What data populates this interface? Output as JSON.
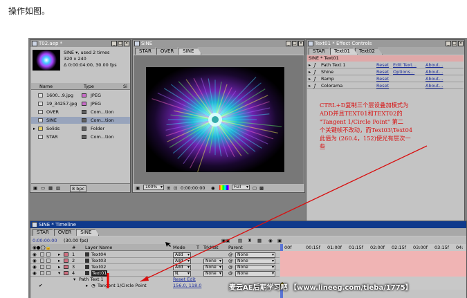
{
  "caption": "操作如图。",
  "project": {
    "title": "T02.aep *",
    "item_name": "SINE ▾, used 2 times",
    "item_size": "320 x 240",
    "item_duration": "Δ 0:00:04:00, 30.00 fps",
    "col_name": "Name",
    "col_type": "Type",
    "col_size": "Si",
    "items": [
      {
        "name": "1600...9.jpg",
        "type": "JPEG",
        "color": "#c86cc8"
      },
      {
        "name": "19_34257.jpg",
        "type": "JPEG",
        "color": "#c86cc8"
      },
      {
        "name": "OVER",
        "type": "Com...tion",
        "color": "#606060"
      },
      {
        "name": "SINE",
        "type": "Com...tion",
        "color": "#606060"
      },
      {
        "name": "Solids",
        "type": "Folder",
        "color": "#606060"
      },
      {
        "name": "STAR",
        "type": "Com...tion",
        "color": "#606060"
      }
    ],
    "bpc": "8 bpc"
  },
  "comp": {
    "title": "SINE",
    "tabs": [
      "STAR",
      "OVER",
      "SINE"
    ],
    "zoom": "100%",
    "timecode": "0:00:00:00",
    "resolution": "Full"
  },
  "effects": {
    "title": "Text01 * Effect Controls",
    "tabs": [
      "STAR",
      "Text01",
      "Text02"
    ],
    "header": "SINE * Text01",
    "rows": [
      {
        "name": "Path Text 1",
        "reset": "Reset",
        "extra": "Edit Text...",
        "about": "About..."
      },
      {
        "name": "Shine",
        "reset": "Reset",
        "extra": "Options...",
        "about": "About..."
      },
      {
        "name": "Ramp",
        "reset": "Reset",
        "extra": "",
        "about": "About..."
      },
      {
        "name": "Colorama",
        "reset": "Reset",
        "extra": "",
        "about": "About..."
      }
    ]
  },
  "note": {
    "lines": [
      "CTRL+D复制三个层设叠加模式为",
      "ADD并且TEXT01和TEXT02的",
      "\"Tangent 1/Circle Point\" 第二",
      "个关键帧不改动，而Text03\\Text04",
      "此值为 (260.4，152)使光有层次一",
      "些"
    ]
  },
  "timeline": {
    "title": "SINE * Timeline",
    "tabs": [
      "STAR",
      "OVER",
      "SINE"
    ],
    "timecode": "0:00:00:00",
    "fps": "(30.00 fps)",
    "col_num": "#",
    "col_layer": "Layer Name",
    "col_mode": "Mode",
    "col_t": "T",
    "col_trkmat": "TrkMat",
    "col_parent": "Parent",
    "layers": [
      {
        "num": "1",
        "name": "Text04",
        "mode": "Add",
        "trkmat": "",
        "parent": "None"
      },
      {
        "num": "2",
        "name": "Text03",
        "mode": "Add",
        "trkmat": "None",
        "parent": "None"
      },
      {
        "num": "3",
        "name": "Text02",
        "mode": "Add",
        "trkmat": "None",
        "parent": "None"
      },
      {
        "num": "4",
        "name": "Text01",
        "mode": "N.",
        "trkmat": "None",
        "parent": "None"
      }
    ],
    "sub1_name": "Path Text 1",
    "sub1_value": "Reset Edit",
    "sub2_name": "Tangent 1/Circle Point",
    "sub2_value": "156.0, 118.0",
    "ruler": [
      "00f",
      "00:15f",
      "01:00f",
      "01:15f",
      "02:00f",
      "02:15f",
      "03:00f",
      "03:15f",
      "04:"
    ]
  },
  "watermark": "麦云AE后期学习吧 【www.lineeg.com/tieba/1775】",
  "colors": {
    "accent": "#103a8c",
    "annotation": "#d81010",
    "track": "#f0b4b4"
  }
}
